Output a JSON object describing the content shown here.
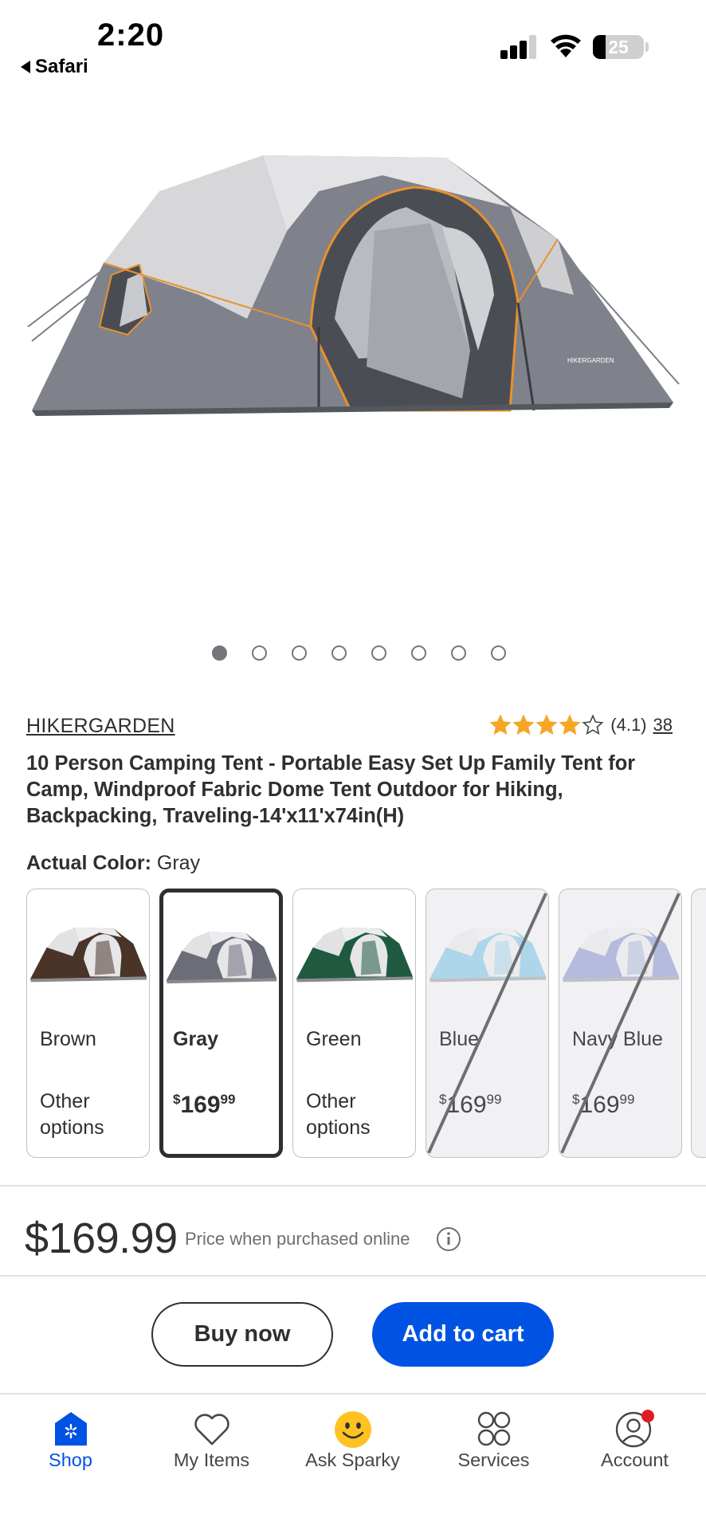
{
  "status_bar": {
    "time": "2:20",
    "back_app": "Safari",
    "battery": "25",
    "battery_level": 0.25
  },
  "gallery": {
    "image_label": "HIKERGARDEN",
    "dot_count": 8,
    "active_index": 0
  },
  "product": {
    "brand": "HIKERGARDEN",
    "rating_value": 4.1,
    "rating_text": "(4.1)",
    "review_count": "38",
    "title": "10 Person Camping Tent - Portable Easy Set Up Family Tent for Camp, Windproof Fabric Dome Tent Outdoor for Hiking, Backpacking, Traveling-14'x11'x74in(H)",
    "color_label": "Actual Color:",
    "color_value": "Gray"
  },
  "swatches": [
    {
      "name": "Brown",
      "detail": "Other options",
      "price_dollars": "",
      "price_cents": "",
      "currency": "",
      "state": "available",
      "color": "#4a3428"
    },
    {
      "name": "Gray",
      "detail": "",
      "price_dollars": "169",
      "price_cents": "99",
      "currency": "$",
      "state": "selected",
      "color": "#6b6e78"
    },
    {
      "name": "Green",
      "detail": "Other options",
      "price_dollars": "",
      "price_cents": "",
      "currency": "",
      "state": "available",
      "color": "#1f5a40"
    },
    {
      "name": "Blue",
      "detail": "",
      "price_dollars": "169",
      "price_cents": "99",
      "currency": "$",
      "state": "unavailable",
      "color": "#5bb6e0"
    },
    {
      "name": "Navy Blue",
      "detail": "",
      "price_dollars": "169",
      "price_cents": "99",
      "currency": "$",
      "state": "unavailable",
      "color": "#6c7bc2"
    }
  ],
  "price": {
    "amount": "$169.99",
    "note": "Price when purchased online"
  },
  "actions": {
    "buy_now": "Buy now",
    "add_to_cart": "Add to cart"
  },
  "nav": {
    "items": [
      {
        "label": "Shop",
        "icon": "shop-icon"
      },
      {
        "label": "My Items",
        "icon": "heart-icon"
      },
      {
        "label": "Ask Sparky",
        "icon": "sparky-icon"
      },
      {
        "label": "Services",
        "icon": "services-icon"
      },
      {
        "label": "Account",
        "icon": "account-icon"
      }
    ]
  },
  "colors": {
    "accent": "#0053e2",
    "text": "#2e2f32",
    "star": "#f5a623",
    "notification": "#de1c24",
    "sparky": "#ffc220"
  }
}
